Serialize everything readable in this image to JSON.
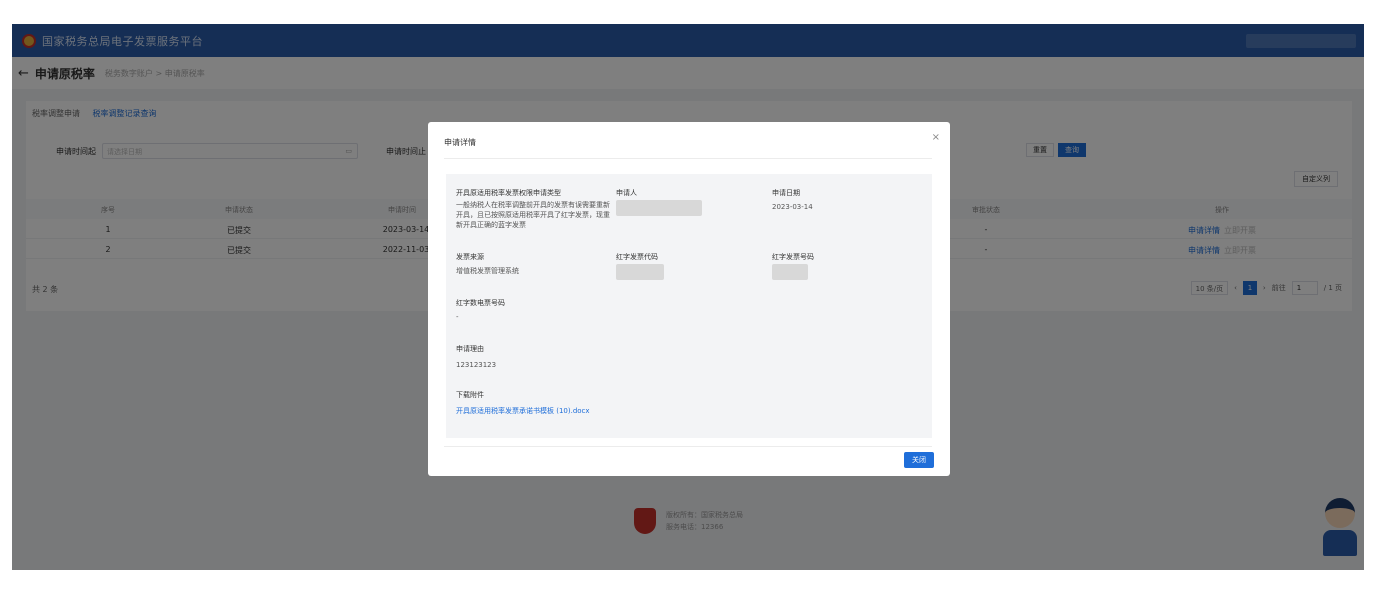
{
  "app": {
    "title": "国家税务总局电子发票服务平台"
  },
  "header": {
    "page_title": "申请原税率",
    "breadcrumb": "税务数字账户 > 申请原税率"
  },
  "tabs": {
    "apply": "税率调整申请",
    "history": "税率调整记录查询"
  },
  "filters": {
    "date_label": "申请时间起",
    "date_placeholder": "请选择日期",
    "date_end_label": "申请时间止",
    "reset_label": "重置",
    "query_label": "查询",
    "columns_label": "自定义列"
  },
  "table": {
    "headers": [
      "序号",
      "申请状态",
      "申请时间",
      "审批状态",
      "操作"
    ],
    "rows": [
      {
        "index": "1",
        "status": "已提交",
        "date": "2023-03-14",
        "approval": "-",
        "action": "申请详情",
        "action2": "立即开票"
      },
      {
        "index": "2",
        "status": "已提交",
        "date": "2022-11-03",
        "approval": "-",
        "action": "申请详情",
        "action2": "立即开票"
      }
    ],
    "total": "共 2 条"
  },
  "pagination": {
    "page_size": "10 条/页",
    "current": "1",
    "goto_label": "前往",
    "goto_value": "1",
    "total_pages": "/ 1 页"
  },
  "footer": {
    "line1": "版权所有：国家税务总局",
    "line2": "服务电话：12366"
  },
  "modal": {
    "title": "申请详情",
    "fields": {
      "type_label": "开具原适用税率发票权限申请类型",
      "type_value": "一般纳税人在税率调整前开具的发票有误需要重新开具，且已按照原适用税率开具了红字发票，现重新开具正确的蓝字发票",
      "applicant_label": "申请人",
      "apply_date_label": "申请日期",
      "apply_date_value": "2023-03-14",
      "source_label": "发票来源",
      "source_value": "增值税发票管理系统",
      "red_code_label": "红字发票代码",
      "red_number_label": "红字发票号码",
      "red_digital_label": "红字数电票号码",
      "red_digital_value": "-",
      "reason_label": "申请理由",
      "reason_value": "123123123",
      "attachment_label": "下载附件",
      "attachment_value": "开具原适用税率发票承诺书模板 (10).docx"
    },
    "close_label": "关闭"
  }
}
